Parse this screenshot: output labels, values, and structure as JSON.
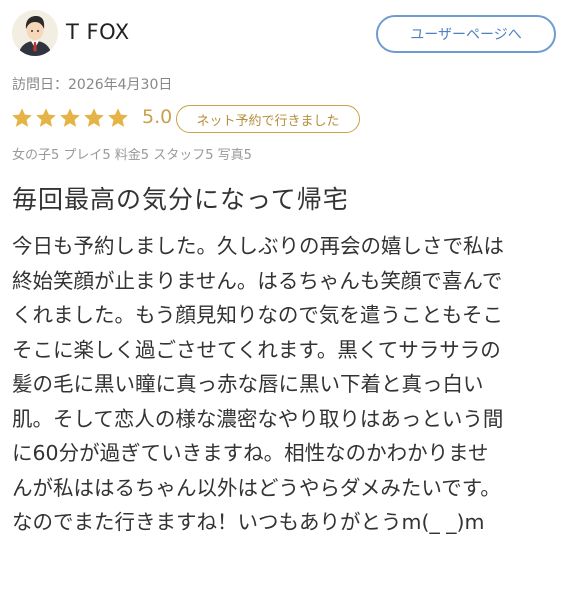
{
  "header": {
    "username": "T FOX",
    "user_page_button": "ユーザーページへ"
  },
  "visit": {
    "label": "訪問日：2026年4月30日"
  },
  "rating": {
    "stars": 5,
    "max_stars": 5,
    "star_color": "#e5b448",
    "score": "5.0",
    "booking_badge": "ネット予約で行きました",
    "breakdown": "女の子5 プレイ5 料金5 スタッフ5 写真5"
  },
  "review": {
    "title": "毎回最高の気分になって帰宅",
    "lines": [
      "今日も予約しました。久しぶりの再会の嬉しさで私は",
      "終始笑顔が止まりません。はるちゃんも笑顔で喜んで",
      "くれました。もう顔見知りなので気を遣うこともそこ",
      "そこに楽しく過ごさせてくれます。黒くてサラサラの",
      "髪の毛に黒い瞳に真っ赤な唇に黒い下着と真っ白い",
      "肌。そして恋人の様な濃密なやり取りはあっという間",
      "に60分が過ぎていきますね。相性なのかわかりませ",
      "んが私ははるちゃん以外はどうやらダメみたいです。",
      "なのでまた行きますね！いつもありがとうm(_ _)m"
    ]
  }
}
